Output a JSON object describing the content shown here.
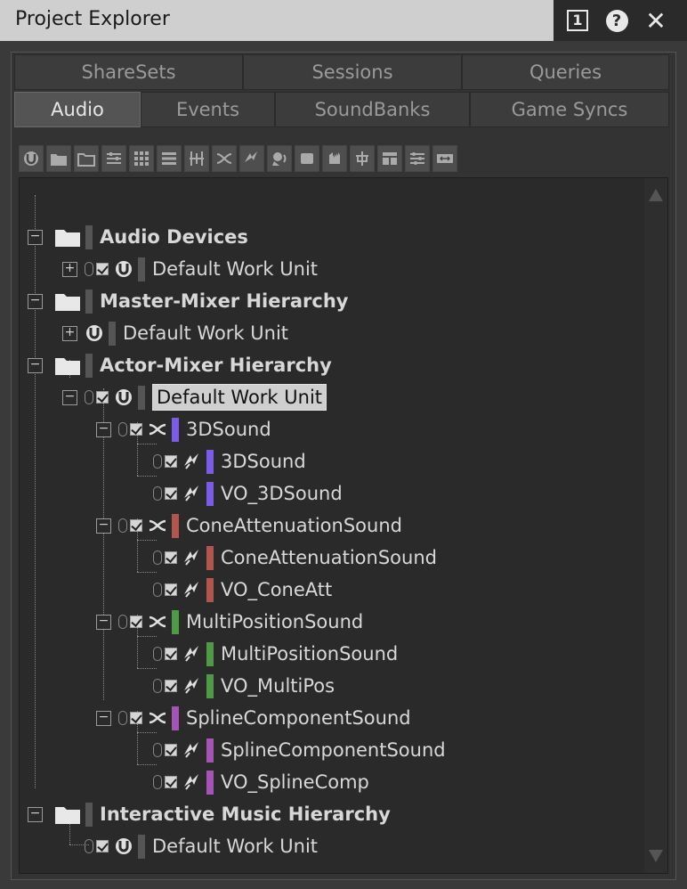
{
  "window": {
    "title": "Project Explorer",
    "pin_number": "1",
    "help_glyph": "?",
    "close_glyph": "✕"
  },
  "tabs_row1": [
    {
      "label": "ShareSets"
    },
    {
      "label": "Sessions"
    },
    {
      "label": "Queries"
    }
  ],
  "tabs_row2": [
    {
      "label": "Audio",
      "active": true
    },
    {
      "label": "Events"
    },
    {
      "label": "SoundBanks"
    },
    {
      "label": "Game Syncs"
    }
  ],
  "toolbar": {
    "icons": [
      "work-unit-icon",
      "folder-icon",
      "virtual-folder-icon",
      "actor-mixer-icon",
      "blend-container-icon",
      "sequence-container-icon",
      "switch-container-icon",
      "random-container-icon",
      "sound-sfx-icon",
      "sound-voice-icon",
      "audio-source-icon",
      "music-segment-icon",
      "music-track-icon",
      "music-switch-icon",
      "music-playlist-icon",
      "bus-icon"
    ]
  },
  "colors": {
    "purple_blue": "#7b5ce8",
    "red": "#b3554f",
    "green": "#4e9a47",
    "magenta": "#a553b4",
    "neutral": "#555555"
  },
  "tree": {
    "audio_devices": {
      "label": "Audio Devices",
      "child": "Default Work Unit"
    },
    "master_mixer": {
      "label": "Master-Mixer Hierarchy",
      "child": "Default Work Unit"
    },
    "actor_mixer": {
      "label": "Actor-Mixer Hierarchy",
      "work_unit": "Default Work Unit",
      "containers": [
        {
          "label": "3DSound",
          "color": "#7b5ce8",
          "children": [
            "3DSound",
            "VO_3DSound"
          ]
        },
        {
          "label": "ConeAttenuationSound",
          "color": "#b3554f",
          "children": [
            "ConeAttenuationSound",
            "VO_ConeAtt"
          ]
        },
        {
          "label": "MultiPositionSound",
          "color": "#4e9a47",
          "children": [
            "MultiPositionSound",
            "VO_MultiPos"
          ]
        },
        {
          "label": "SplineComponentSound",
          "color": "#a553b4",
          "children": [
            "SplineComponentSound",
            "VO_SplineComp"
          ]
        }
      ]
    },
    "interactive_music": {
      "label": "Interactive Music Hierarchy",
      "child": "Default Work Unit"
    }
  }
}
